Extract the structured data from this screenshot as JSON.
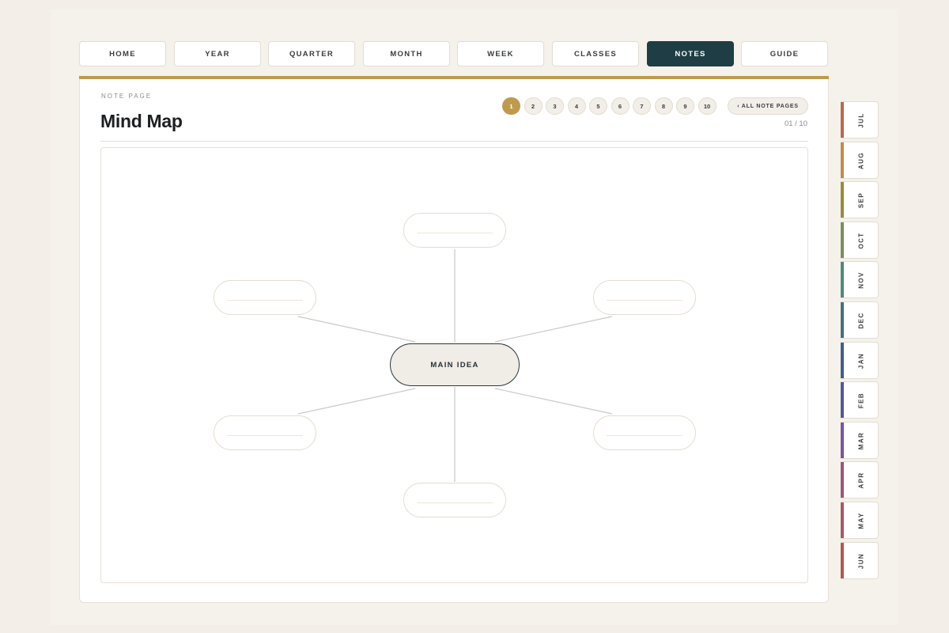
{
  "nav": {
    "tabs": [
      {
        "label": "HOME",
        "active": false
      },
      {
        "label": "YEAR",
        "active": false
      },
      {
        "label": "QUARTER",
        "active": false
      },
      {
        "label": "MONTH",
        "active": false
      },
      {
        "label": "WEEK",
        "active": false
      },
      {
        "label": "CLASSES",
        "active": false
      },
      {
        "label": "NOTES",
        "active": true
      },
      {
        "label": "GUIDE",
        "active": false
      }
    ]
  },
  "page": {
    "eyebrow": "NOTE PAGE",
    "title": "Mind Map",
    "counter": "01 / 10",
    "all_pages_button": "‹ ALL NOTE PAGES",
    "pages": [
      {
        "label": "1",
        "active": true
      },
      {
        "label": "2",
        "active": false
      },
      {
        "label": "3",
        "active": false
      },
      {
        "label": "4",
        "active": false
      },
      {
        "label": "5",
        "active": false
      },
      {
        "label": "6",
        "active": false
      },
      {
        "label": "7",
        "active": false
      },
      {
        "label": "8",
        "active": false
      },
      {
        "label": "9",
        "active": false
      },
      {
        "label": "10",
        "active": false
      }
    ]
  },
  "mindmap": {
    "center_label": "MAIN IDEA",
    "branches": [
      "top",
      "upper-left",
      "upper-right",
      "lower-left",
      "lower-right",
      "bottom"
    ]
  },
  "months": [
    {
      "label": "JUL",
      "color": "#b8694f"
    },
    {
      "label": "AUG",
      "color": "#bf8c4c"
    },
    {
      "label": "SEP",
      "color": "#9a8a3e"
    },
    {
      "label": "OCT",
      "color": "#7a8f5c"
    },
    {
      "label": "NOV",
      "color": "#4f8a7a"
    },
    {
      "label": "DEC",
      "color": "#3f7285"
    },
    {
      "label": "JAN",
      "color": "#3f5f8a"
    },
    {
      "label": "FEB",
      "color": "#54589a"
    },
    {
      "label": "MAR",
      "color": "#77579a"
    },
    {
      "label": "APR",
      "color": "#96567f"
    },
    {
      "label": "MAY",
      "color": "#a45a68"
    },
    {
      "label": "JUN",
      "color": "#b05a4e"
    }
  ],
  "colors": {
    "accent_gold": "#bf9a4c",
    "active_tab": "#1f3d45",
    "background": "#f3eee8"
  }
}
